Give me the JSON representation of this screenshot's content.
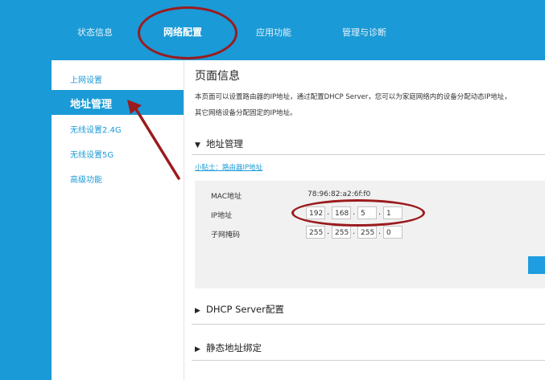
{
  "topnav": {
    "items": [
      {
        "label": "状态信息"
      },
      {
        "label": "网络配置"
      },
      {
        "label": "应用功能"
      },
      {
        "label": "管理与诊断"
      }
    ]
  },
  "sidebar": {
    "items": [
      {
        "label": "上网设置"
      },
      {
        "label": "地址管理"
      },
      {
        "label": "无线设置2.4G"
      },
      {
        "label": "无线设置5G"
      },
      {
        "label": "高级功能"
      }
    ]
  },
  "main": {
    "title": "页面信息",
    "description_line1": "本页面可以设置路由器的IP地址，通过配置DHCP Server，您可以为家庭网络内的设备分配动态IP地址，",
    "description_line2": "其它网络设备分配固定的IP地址。",
    "section_address": "地址管理",
    "tip_link": "小贴士：路由器IP地址",
    "mac_label": "MAC地址",
    "mac_value": "78:96:82:a2:6f:f0",
    "ip_label": "IP地址",
    "ip": [
      "192",
      "168",
      "5",
      "1"
    ],
    "mask_label": "子网掩码",
    "mask": [
      "255",
      "255",
      "255",
      "0"
    ],
    "section_dhcp": "DHCP Server配置",
    "section_static": "静态地址绑定"
  },
  "colors": {
    "brand": "#1a9ad6",
    "annotation": "#9b1b1e"
  }
}
